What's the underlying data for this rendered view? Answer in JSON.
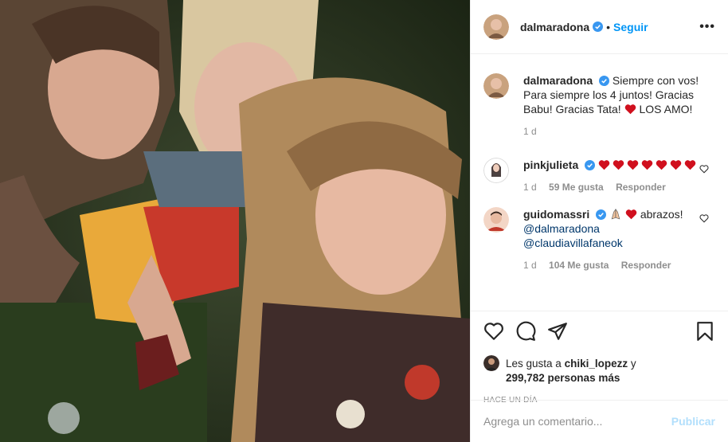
{
  "photo": {
    "alt_icon": "selfie-photo"
  },
  "header": {
    "username": "dalmaradona",
    "dot": "•",
    "follow_label": "Seguir",
    "more_label": "•••"
  },
  "caption": {
    "username": "dalmaradona",
    "text": "Siempre con vos! Para siempre los 4 juntos! Gracias Babu! Gracias Tata!",
    "text_end": "LOS AMO!",
    "time": "1 d"
  },
  "comments": [
    {
      "username": "pinkjulieta",
      "hearts": 7,
      "time": "1 d",
      "likes": "59 Me gusta",
      "reply": "Responder"
    },
    {
      "username": "guidomassri",
      "text": "abrazos!",
      "mention1": "@dalmaradona",
      "mention2": "@claudiavillafaneok",
      "time": "1 d",
      "likes": "104 Me gusta",
      "reply": "Responder"
    }
  ],
  "likes": {
    "prefix": "Les gusta a",
    "user": "chiki_lopezz",
    "joiner": "y",
    "count": "299,782 personas más"
  },
  "timestamp": "HACE UN DÍA",
  "add_comment": {
    "placeholder": "Agrega un comentario...",
    "publish": "Publicar"
  },
  "colors": {
    "link": "#0095f6",
    "verified": "#3897f0",
    "heart": "#ed4956",
    "muted": "#8e8e8e"
  }
}
